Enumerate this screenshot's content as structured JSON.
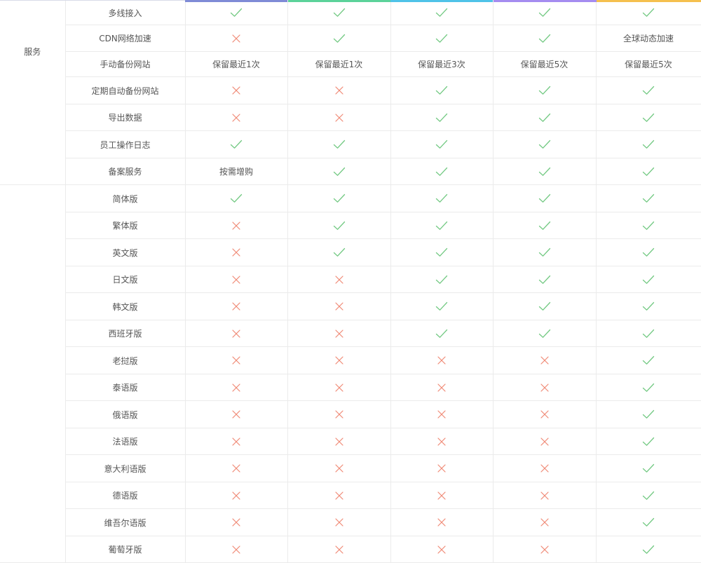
{
  "colors": {
    "check": "#72c982",
    "cross": "#f08a76",
    "plan_bars": [
      "#7f8bd6",
      "#5bd29a",
      "#4fc3e8",
      "#a58cf0",
      "#f5c04e"
    ]
  },
  "icons": {
    "check": "check-icon",
    "cross": "cross-icon"
  },
  "groups": [
    {
      "label": "服务",
      "rows": [
        {
          "feature": "多线接入",
          "height": 35,
          "values": [
            "check",
            "check",
            "check",
            "check",
            "check"
          ]
        },
        {
          "feature": "CDN网络加速",
          "height": 38,
          "values": [
            "cross",
            "check",
            "check",
            "check",
            "全球动态加速"
          ]
        },
        {
          "feature": "手动备份网站",
          "height": 36,
          "values": [
            "保留最近1次",
            "保留最近1次",
            "保留最近3次",
            "保留最近5次",
            "保留最近5次"
          ]
        },
        {
          "feature": "定期自动备份网站",
          "height": 39,
          "values": [
            "cross",
            "cross",
            "check",
            "check",
            "check"
          ]
        },
        {
          "feature": "导出数据",
          "height": 38,
          "values": [
            "cross",
            "cross",
            "check",
            "check",
            "check"
          ]
        },
        {
          "feature": "员工操作日志",
          "height": 39,
          "values": [
            "check",
            "check",
            "check",
            "check",
            "check"
          ]
        },
        {
          "feature": "备案服务",
          "height": 38,
          "values": [
            "按需增购",
            "check",
            "check",
            "check",
            "check"
          ]
        }
      ]
    },
    {
      "label": "",
      "rows": [
        {
          "feature": "简体版",
          "height": 39,
          "values": [
            "check",
            "check",
            "check",
            "check",
            "check"
          ]
        },
        {
          "feature": "繁体版",
          "height": 38,
          "values": [
            "cross",
            "check",
            "check",
            "check",
            "check"
          ]
        },
        {
          "feature": "英文版",
          "height": 39,
          "values": [
            "cross",
            "check",
            "check",
            "check",
            "check"
          ]
        },
        {
          "feature": "日文版",
          "height": 38,
          "values": [
            "cross",
            "cross",
            "check",
            "check",
            "check"
          ]
        },
        {
          "feature": "韩文版",
          "height": 39,
          "values": [
            "cross",
            "cross",
            "check",
            "check",
            "check"
          ]
        },
        {
          "feature": "西班牙版",
          "height": 38,
          "values": [
            "cross",
            "cross",
            "check",
            "check",
            "check"
          ]
        },
        {
          "feature": "老挝版",
          "height": 39,
          "values": [
            "cross",
            "cross",
            "cross",
            "cross",
            "check"
          ]
        },
        {
          "feature": "泰语版",
          "height": 38,
          "values": [
            "cross",
            "cross",
            "cross",
            "cross",
            "check"
          ]
        },
        {
          "feature": "俄语版",
          "height": 39,
          "values": [
            "cross",
            "cross",
            "cross",
            "cross",
            "check"
          ]
        },
        {
          "feature": "法语版",
          "height": 38,
          "values": [
            "cross",
            "cross",
            "cross",
            "cross",
            "check"
          ]
        },
        {
          "feature": "意大利语版",
          "height": 39,
          "values": [
            "cross",
            "cross",
            "cross",
            "cross",
            "check"
          ]
        },
        {
          "feature": "德语版",
          "height": 38,
          "values": [
            "cross",
            "cross",
            "cross",
            "cross",
            "check"
          ]
        },
        {
          "feature": "维吾尔语版",
          "height": 39,
          "values": [
            "cross",
            "cross",
            "cross",
            "cross",
            "check"
          ]
        },
        {
          "feature": "葡萄牙版",
          "height": 38,
          "values": [
            "cross",
            "cross",
            "cross",
            "cross",
            "check"
          ]
        }
      ]
    }
  ]
}
